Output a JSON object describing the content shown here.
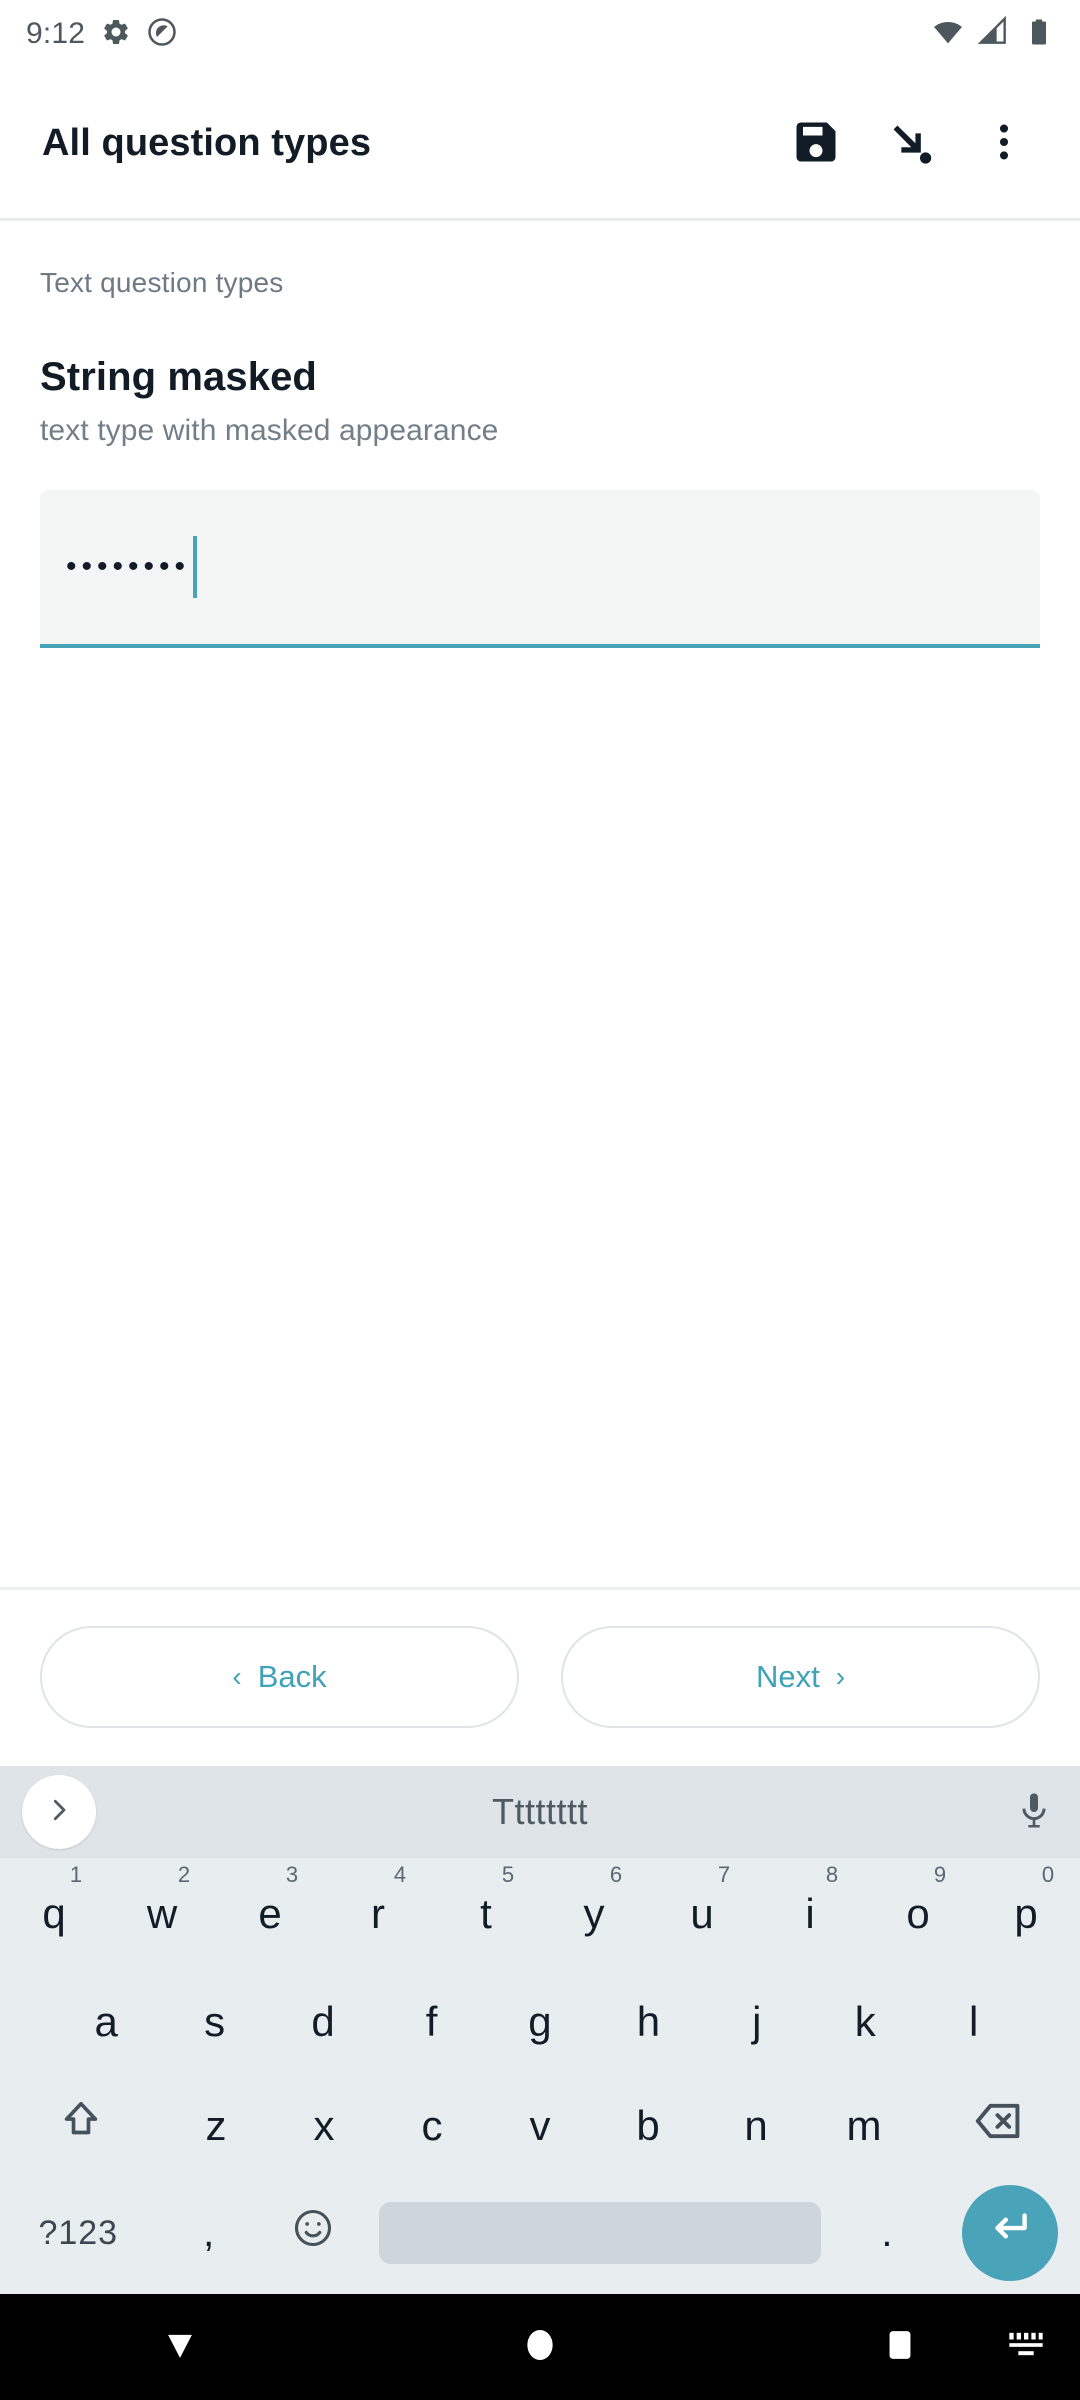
{
  "status_bar": {
    "clock": "9:12",
    "left_icons": [
      "gear-icon",
      "privacy-indicator-icon"
    ],
    "right_icons": [
      "wifi-icon",
      "cellular-signal-icon",
      "battery-icon"
    ],
    "icon_color": "#4d575e"
  },
  "app_bar": {
    "title": "All question types",
    "actions": [
      {
        "name": "save-icon",
        "label": "Save"
      },
      {
        "name": "goto-icon",
        "label": "Go to"
      },
      {
        "name": "more-options-icon",
        "label": "More options"
      }
    ],
    "title_color": "#111c26"
  },
  "form": {
    "group_label": "Text question types",
    "question_title": "String masked",
    "question_hint": "text type with masked appearance",
    "field": {
      "name": "string-masked-input",
      "masked_value": "••••••••",
      "plain_value": "Tttttttt",
      "character_count": 8,
      "placeholder": "",
      "focused": true,
      "accent_color": "#47a3b8",
      "background_color": "#f4f6f6"
    }
  },
  "nav_buttons": {
    "back": {
      "label": "Back",
      "chevron": "‹"
    },
    "next": {
      "label": "Next",
      "chevron": "›"
    },
    "accent_color": "#3fa2b8"
  },
  "keyboard": {
    "accent_color": "#49a4ba",
    "background_color": "#e8edf0",
    "suggestion_strip": {
      "expand_icon": "chevron-right-icon",
      "suggestion": "Tttttttt",
      "mic_icon": "microphone-icon",
      "background_color": "#dee4e8"
    },
    "row1": [
      {
        "key": "q",
        "num": "1"
      },
      {
        "key": "w",
        "num": "2"
      },
      {
        "key": "e",
        "num": "3"
      },
      {
        "key": "r",
        "num": "4"
      },
      {
        "key": "t",
        "num": "5"
      },
      {
        "key": "y",
        "num": "6"
      },
      {
        "key": "u",
        "num": "7"
      },
      {
        "key": "i",
        "num": "8"
      },
      {
        "key": "o",
        "num": "9"
      },
      {
        "key": "p",
        "num": "0"
      }
    ],
    "row2": [
      "a",
      "s",
      "d",
      "f",
      "g",
      "h",
      "j",
      "k",
      "l"
    ],
    "row3": {
      "shift": "shift-key-icon",
      "keys": [
        "z",
        "x",
        "c",
        "v",
        "b",
        "n",
        "m"
      ],
      "backspace": "backspace-key-icon"
    },
    "row4": {
      "symbols": "?123",
      "comma": ",",
      "emoji": "emoji-icon",
      "space": "spacebar",
      "period": ".",
      "enter": "enter-key-icon"
    }
  },
  "system_nav": {
    "back": "back-triangle-icon",
    "home": "home-circle-icon",
    "recents": "recents-square-icon",
    "keyboard_switch": "keyboard-switch-icon",
    "background_color": "#000000"
  }
}
